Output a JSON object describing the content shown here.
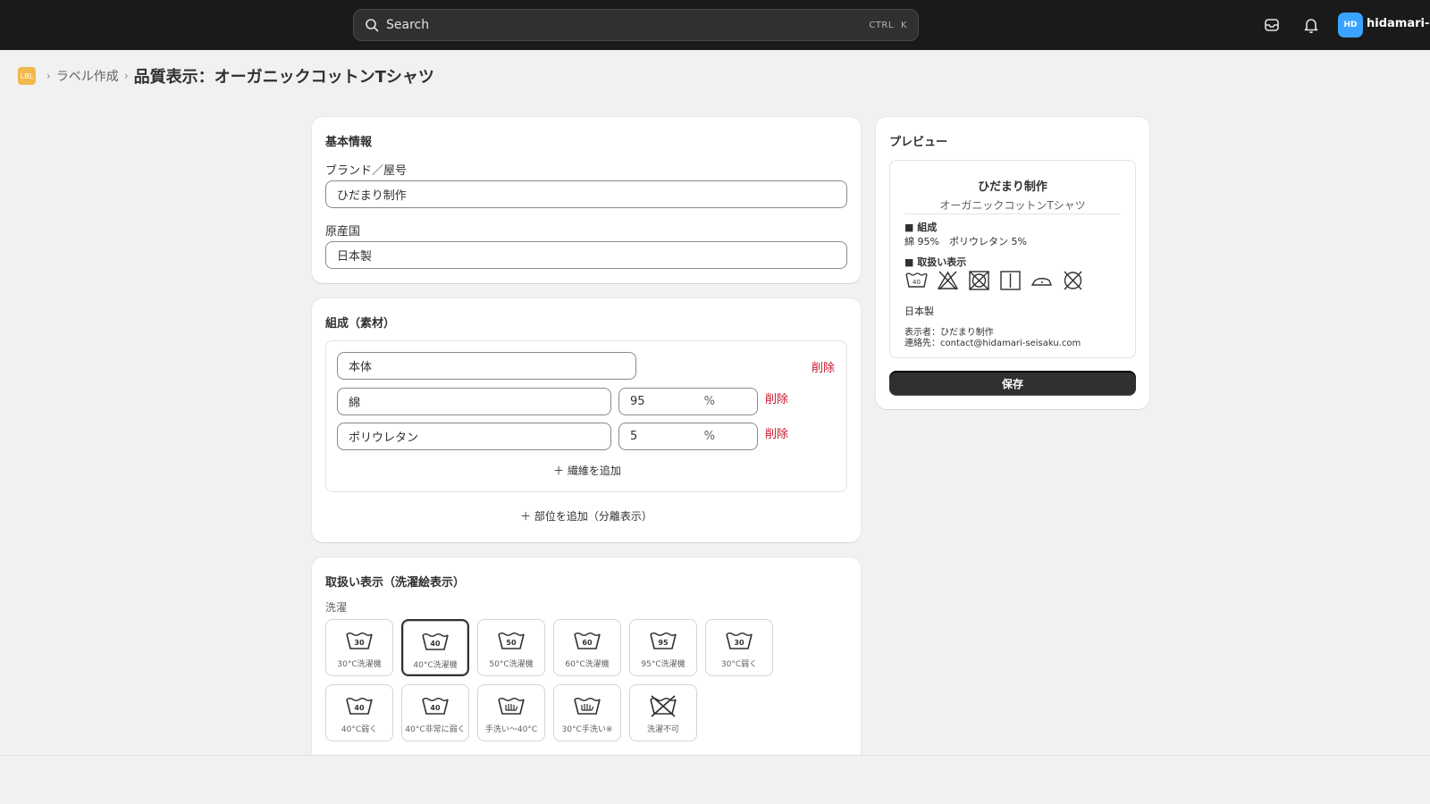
{
  "topbar": {
    "search_placeholder": "Search",
    "shortcut_ctrl": "CTRL",
    "shortcut_key": "K",
    "avatar_initials": "HD",
    "user_name": "hidamari-dev"
  },
  "breadcrumb": {
    "icon_text": "LBL",
    "parent": "ラベル作成",
    "title": "品質表示：オーガニックコットンTシャツ"
  },
  "basic": {
    "title": "基本情報",
    "brand_label": "ブランド／屋号",
    "brand_value": "ひだまり制作",
    "origin_label": "原産国",
    "origin_value": "日本製"
  },
  "composition": {
    "title": "組成（素材）",
    "part_name": "本体",
    "delete_label": "削除",
    "fibers": [
      {
        "name": "綿",
        "percent": "95",
        "unit": "%"
      },
      {
        "name": "ポリウレタン",
        "percent": "5",
        "unit": "%"
      }
    ],
    "add_fiber": "＋ 繊維を追加",
    "add_part": "＋ 部位を追加（分離表示）"
  },
  "care": {
    "title": "取扱い表示（洗濯絵表示）",
    "wash_label": "洗濯",
    "wash_symbols": [
      {
        "temp": "30",
        "caption": "30°C洗濯機"
      },
      {
        "temp": "40",
        "caption": "40°C洗濯機"
      },
      {
        "temp": "50",
        "caption": "50°C洗濯機"
      },
      {
        "temp": "60",
        "caption": "60°C洗濯機"
      },
      {
        "temp": "95",
        "caption": "95°C洗濯機"
      },
      {
        "temp": "30",
        "caption": "30°C弱く"
      },
      {
        "temp": "40",
        "caption": "40°C弱く"
      },
      {
        "temp": "40",
        "caption": "40°C非常に弱く"
      },
      {
        "temp": "",
        "caption": "手洗い〜40°C"
      },
      {
        "temp": "",
        "caption": "30°C手洗い※"
      },
      {
        "temp": "",
        "caption": "洗濯不可"
      }
    ],
    "selected_index": 1
  },
  "preview": {
    "title": "プレビュー",
    "brand": "ひだまり制作",
    "product": "オーガニックコットンTシャツ",
    "composition_heading": "■ 組成",
    "composition_line": "綿 95%　ポリウレタン 5%",
    "care_heading": "■ 取扱い表示",
    "care_icons": [
      "wash-40-icon",
      "no-bleach-icon",
      "no-tumble-dry-icon",
      "line-dry-icon",
      "iron-low-icon",
      "no-dry-clean-icon"
    ],
    "wash_temp": "40",
    "origin": "日本製",
    "labeler": "表示者：ひだまり制作",
    "contact": "連絡先：contact@hidamari-seisaku.com",
    "save_label": "保存"
  }
}
